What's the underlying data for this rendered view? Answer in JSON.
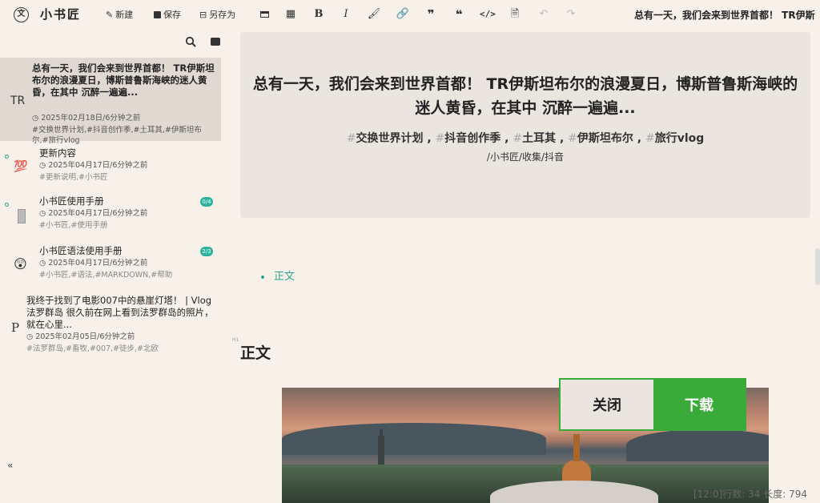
{
  "app": {
    "logo_glyph": "文",
    "name": "小书匠"
  },
  "toolbar": {
    "new_label": "新建",
    "save_label": "保存",
    "save_as_label": "另存为",
    "doc_title": "总有一天，我们会来到世界首都！ TR伊斯"
  },
  "sidebar": {
    "notes": [
      {
        "title": "总有一天，我们会来到世界首都！ TR伊斯坦布尔的浪漫夏日，博斯普鲁斯海峡的迷人黄昏，在其中 沉醉一遍遍...",
        "time": "2025年02月18日/6分钟之前",
        "tags": "#交换世界计划,#抖音创作季,#土耳其,#伊斯坦布尔,#旅行vlog",
        "icon": "TR"
      },
      {
        "title": "更新内容",
        "time": "2025年04月17日/6分钟之前",
        "tags": "#更新说明,#小书匠",
        "icon": "💯"
      },
      {
        "title": "小书匠使用手册",
        "time": "2025年04月17日/6分钟之前",
        "tags": "#小书匠,#使用手册",
        "badge": "0/4"
      },
      {
        "title": "小书匠语法使用手册",
        "time": "2025年04月17日/6分钟之前",
        "tags": "#小书匠,#语法,#MARKDOWN,#帮助",
        "icon": "😲",
        "badge": "2/3"
      },
      {
        "title": "我终于找到了电影007中的悬崖灯塔！ | Vlog 法罗群岛 很久前在网上看到法罗群岛的照片，就在心里...",
        "time": "2025年02月05日/6分钟之前",
        "tags": "#法罗群岛,#畜牧,#007,#徒步,#北欧",
        "icon": "P"
      }
    ]
  },
  "main": {
    "banner": {
      "title": "总有一天，我们会来到世界首都！ TR伊斯坦布尔的浪漫夏日，博斯普鲁斯海峡的迷人黄昏，在其中 沉醉一遍遍...",
      "tags": [
        "交换世界计划",
        "抖音创作季",
        "土耳其",
        "伊斯坦布尔",
        "旅行vlog"
      ],
      "path": "/小书匠/收集/抖音"
    },
    "toc_item": "正文",
    "heading": "正文",
    "heading_mark": "H1"
  },
  "dialog": {
    "close_label": "关闭",
    "download_label": "下载"
  },
  "status": "[12:0]行数: 34 长度: 794"
}
